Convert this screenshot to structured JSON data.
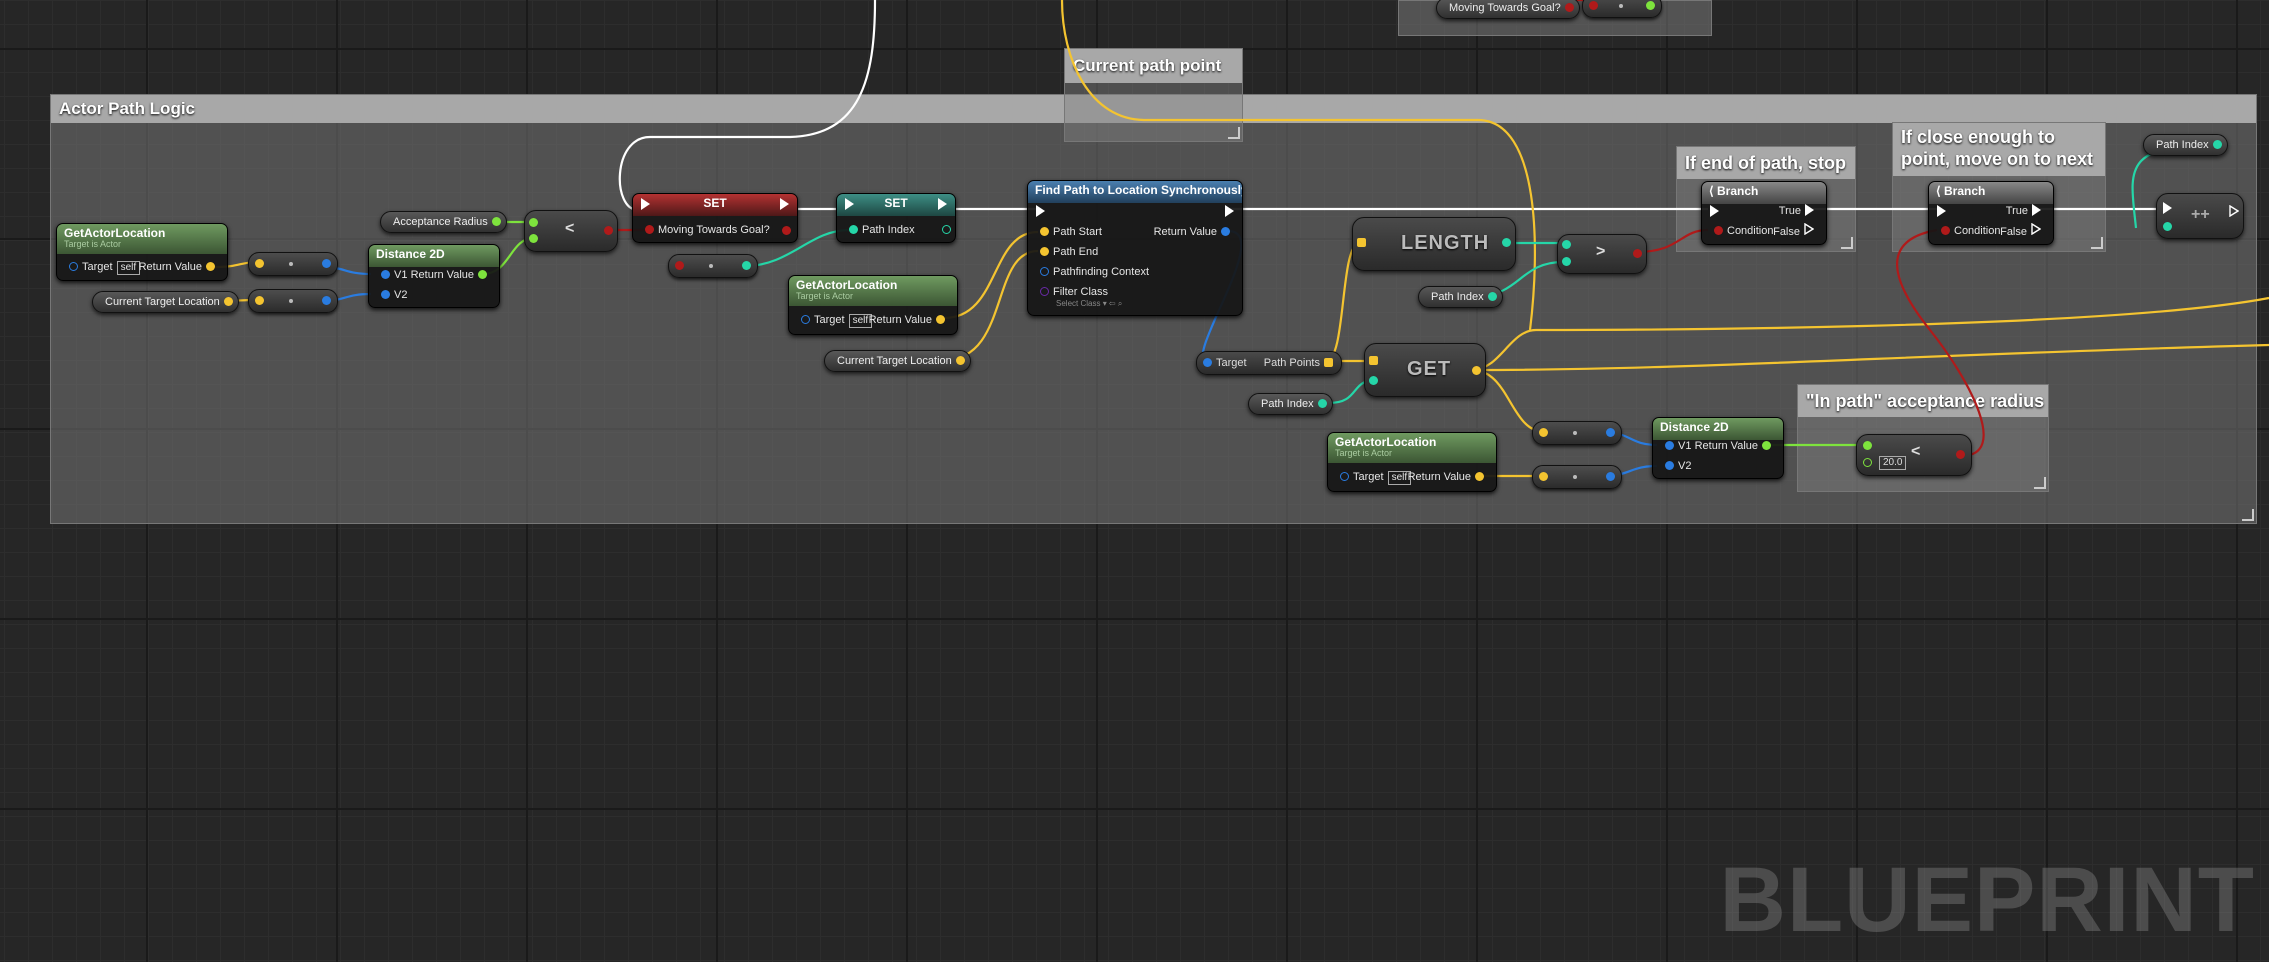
{
  "comments": {
    "main": "Actor Path Logic",
    "current_path_point": "Current path point",
    "end_of_path": "If end of path, stop",
    "close_enough": "If close enough to point, move on to next",
    "in_path": "\"In path\" acceptance radius"
  },
  "nodes": {
    "get_actor_location_1": {
      "title": "GetActorLocation",
      "subtitle": "Target is Actor",
      "target": "Target",
      "self": "self",
      "return": "Return Value"
    },
    "current_target_location_1": "Current Target Location",
    "distance_2d_1": {
      "title": "Distance 2D",
      "v1": "V1",
      "v2": "V2",
      "return": "Return Value"
    },
    "acceptance_radius": "Acceptance Radius",
    "less_than_1": "<",
    "set_moving": {
      "title": "SET",
      "pin": "Moving Towards Goal?"
    },
    "set_path_index": {
      "title": "SET",
      "pin": "Path Index"
    },
    "get_actor_location_2": {
      "title": "GetActorLocation",
      "subtitle": "Target is Actor",
      "target": "Target",
      "self": "self",
      "return": "Return Value"
    },
    "current_target_location_2": "Current Target Location",
    "find_path": {
      "title": "Find Path to Location Synchronously",
      "path_start": "Path Start",
      "path_end": "Path End",
      "context": "Pathfinding Context",
      "filter": "Filter Class",
      "select_class": "Select Class",
      "return": "Return Value"
    },
    "length": "LENGTH",
    "greater_than": ">",
    "path_index_1": "Path Index",
    "path_points": {
      "target": "Target",
      "points": "Path Points"
    },
    "get": "GET",
    "path_index_2": "Path Index",
    "get_actor_location_3": {
      "title": "GetActorLocation",
      "subtitle": "Target is Actor",
      "target": "Target",
      "self": "self",
      "return": "Return Value"
    },
    "distance_2d_2": {
      "title": "Distance 2D",
      "v1": "V1",
      "v2": "V2",
      "return": "Return Value"
    },
    "less_than_2": {
      "symbol": "<",
      "value": "20.0"
    },
    "branch_1": {
      "title": "Branch",
      "condition": "Condition",
      "true": "True",
      "false": "False"
    },
    "branch_2": {
      "title": "Branch",
      "condition": "Condition",
      "true": "True",
      "false": "False"
    },
    "path_index_3": "Path Index",
    "increment": "++",
    "top_partial": "Moving Towards Goal?"
  },
  "watermark": "BLUEPRINT",
  "pin_colors": {
    "vector": "#f4c430",
    "float": "#7ee33d",
    "int": "#25d6a8",
    "object": "#2a7ce0",
    "bool": "#b01a1a",
    "exec": "#ffffff"
  }
}
